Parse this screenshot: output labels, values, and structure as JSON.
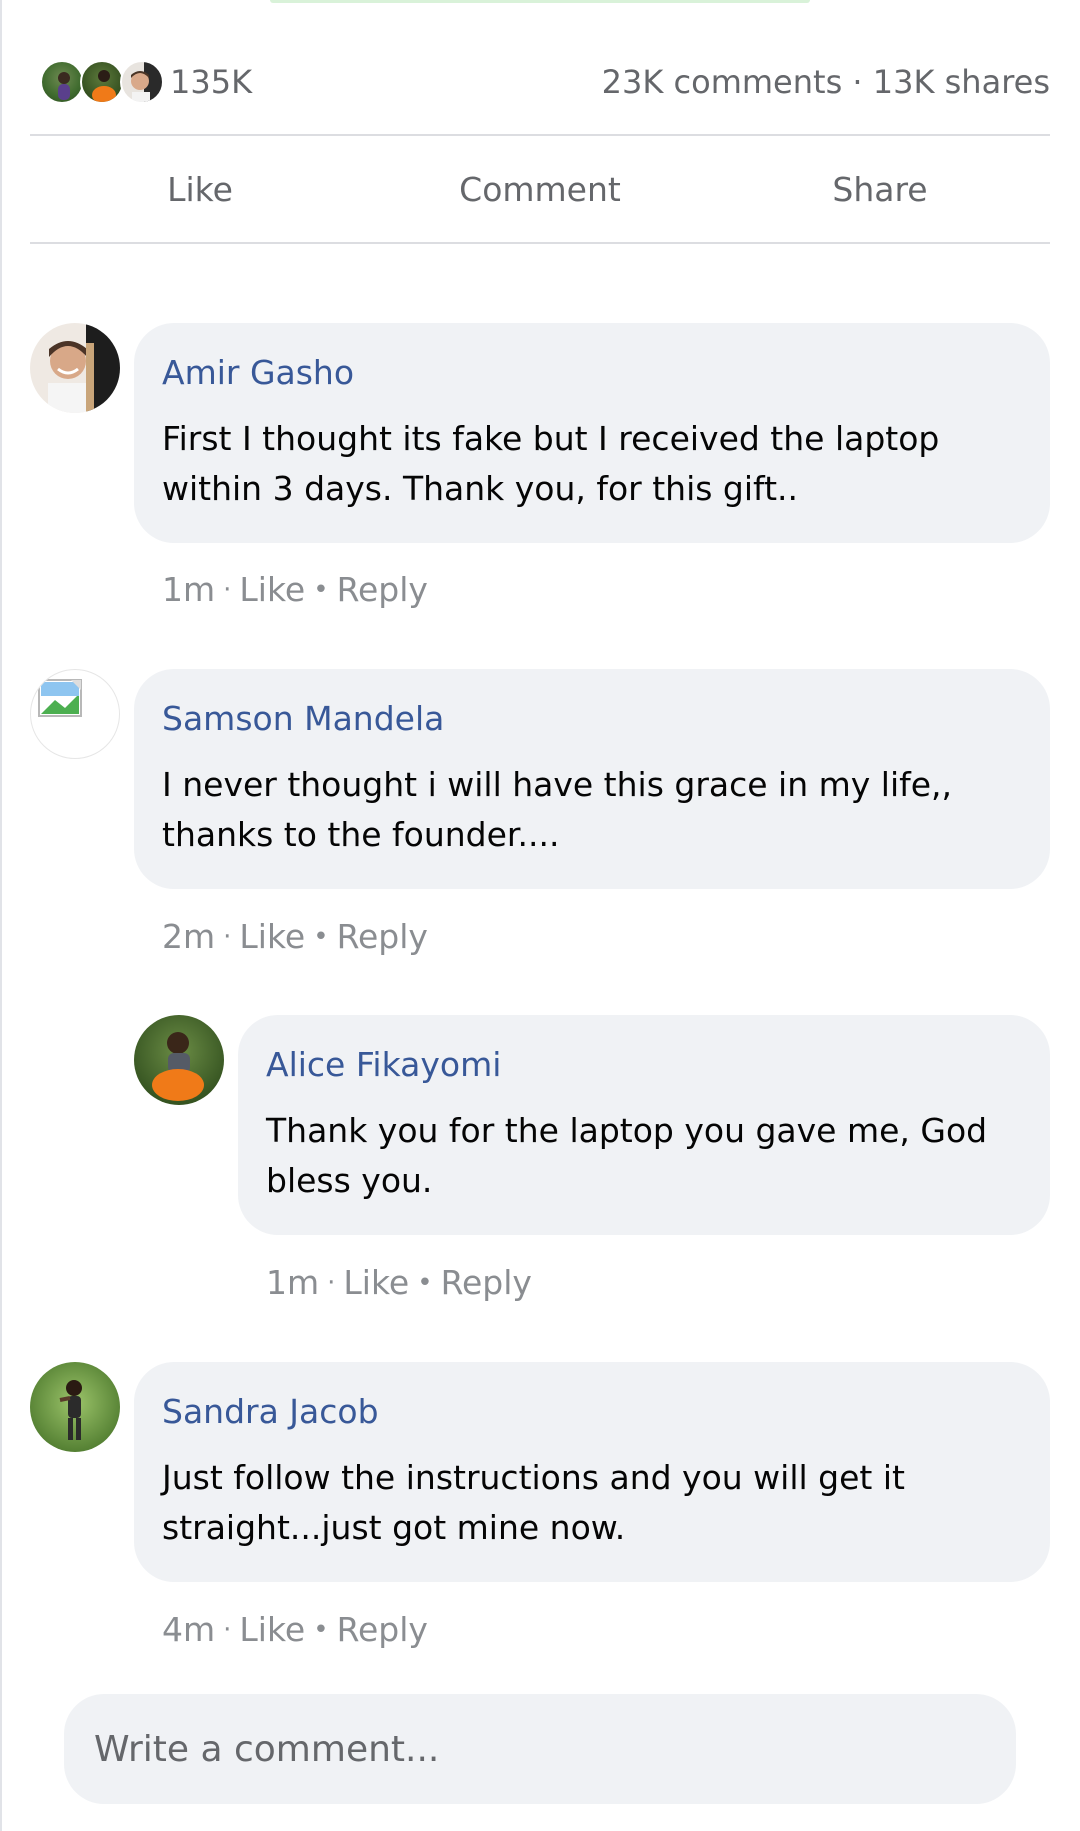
{
  "stats": {
    "reaction_count": "135K",
    "comments_shares": "23K comments · 13K shares"
  },
  "actions": {
    "like": "Like",
    "comment": "Comment",
    "share": "Share"
  },
  "comments": [
    {
      "author": "Amir Gasho",
      "text": "First I thought its fake but I received the laptop within 3 days. Thank you, for this gift..",
      "time": "1m",
      "like": "Like",
      "reply": "Reply"
    },
    {
      "author": "Samson Mandela",
      "text": "I never thought i will have this grace in my life,, thanks to the founder....",
      "time": "2m",
      "like": "Like",
      "reply": "Reply"
    },
    {
      "author": "Alice Fikayomi",
      "text": "Thank you for the laptop you gave me, God bless you.",
      "time": "1m",
      "like": "Like",
      "reply": "Reply"
    },
    {
      "author": "Sandra Jacob",
      "text": "Just follow the instructions and you will get it straight...just got mine now.",
      "time": "4m",
      "like": "Like",
      "reply": "Reply"
    }
  ],
  "composer": {
    "placeholder": "Write a comment..."
  }
}
